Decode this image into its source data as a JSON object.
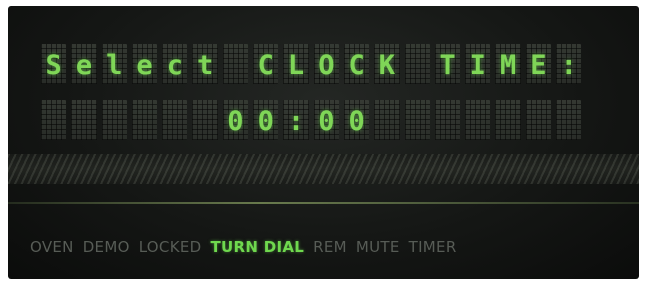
{
  "display": {
    "line1": "Select CLOCK TIME:",
    "line2": "00:00"
  },
  "status_indicators": [
    {
      "label": "OVEN",
      "active": false
    },
    {
      "label": "DEMO",
      "active": false
    },
    {
      "label": "LOCKED",
      "active": false
    },
    {
      "label": "TURN DIAL",
      "active": true
    },
    {
      "label": "REM",
      "active": false
    },
    {
      "label": "MUTE",
      "active": false
    },
    {
      "label": "TIMER",
      "active": false
    }
  ],
  "colors": {
    "lit_segment": "#7fd657",
    "unlit_indicator": "#575c56",
    "panel_background": "#151715"
  }
}
